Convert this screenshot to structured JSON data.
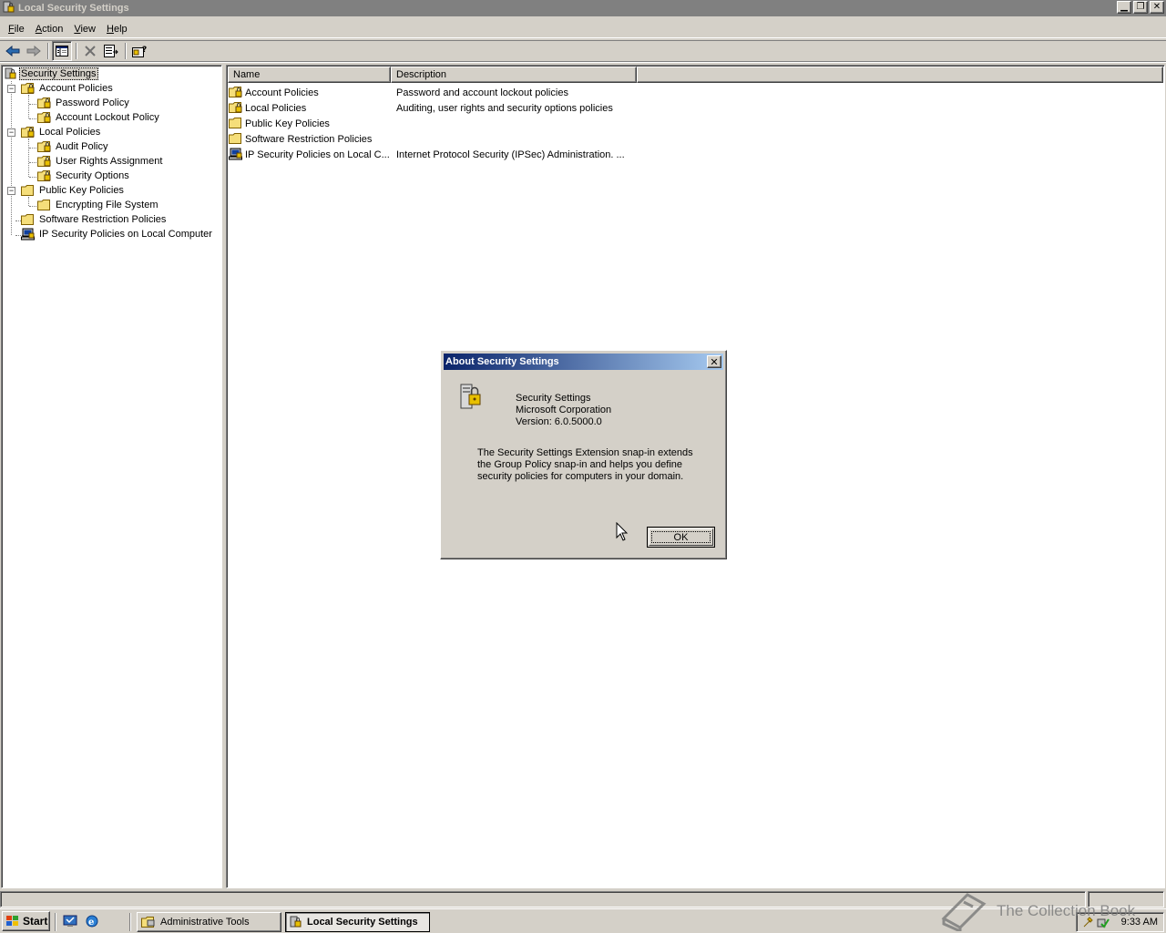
{
  "window": {
    "title": "Local Security Settings"
  },
  "menu": [
    {
      "label": "File",
      "key": "F",
      "rest": "ile"
    },
    {
      "label": "Action",
      "key": "A",
      "rest": "ction"
    },
    {
      "label": "View",
      "key": "V",
      "rest": "iew"
    },
    {
      "label": "Help",
      "key": "H",
      "rest": "elp"
    }
  ],
  "tree": {
    "root": "Security Settings",
    "account_policies": "Account Policies",
    "password_policy": "Password Policy",
    "account_lockout_policy": "Account Lockout Policy",
    "local_policies": "Local Policies",
    "audit_policy": "Audit Policy",
    "user_rights_assignment": "User Rights Assignment",
    "security_options": "Security Options",
    "public_key_policies": "Public Key Policies",
    "encrypting_file_system": "Encrypting File System",
    "software_restriction_policies": "Software Restriction Policies",
    "ip_security_policies": "IP Security Policies on Local Computer"
  },
  "list": {
    "columns": {
      "name": "Name",
      "description": "Description"
    },
    "rows": [
      {
        "name": "Account Policies",
        "description": "Password and account lockout policies"
      },
      {
        "name": "Local Policies",
        "description": "Auditing, user rights and security options policies"
      },
      {
        "name": "Public Key Policies",
        "description": ""
      },
      {
        "name": "Software Restriction Policies",
        "description": ""
      },
      {
        "name": "IP Security Policies on Local C...",
        "description": "Internet Protocol Security (IPSec) Administration. ..."
      }
    ]
  },
  "dialog": {
    "title": "About Security Settings",
    "product": "Security Settings",
    "company": "Microsoft Corporation",
    "version": "Version: 6.0.5000.0",
    "description": "The Security Settings Extension snap-in extends the Group Policy snap-in and helps you define security policies for computers in your domain.",
    "ok_label": "OK"
  },
  "taskbar": {
    "start_label": "Start",
    "tasks": [
      {
        "label": "Administrative Tools"
      },
      {
        "label": "Local Security Settings"
      }
    ],
    "clock": "9:33 AM"
  },
  "watermark": "The Collection Book"
}
